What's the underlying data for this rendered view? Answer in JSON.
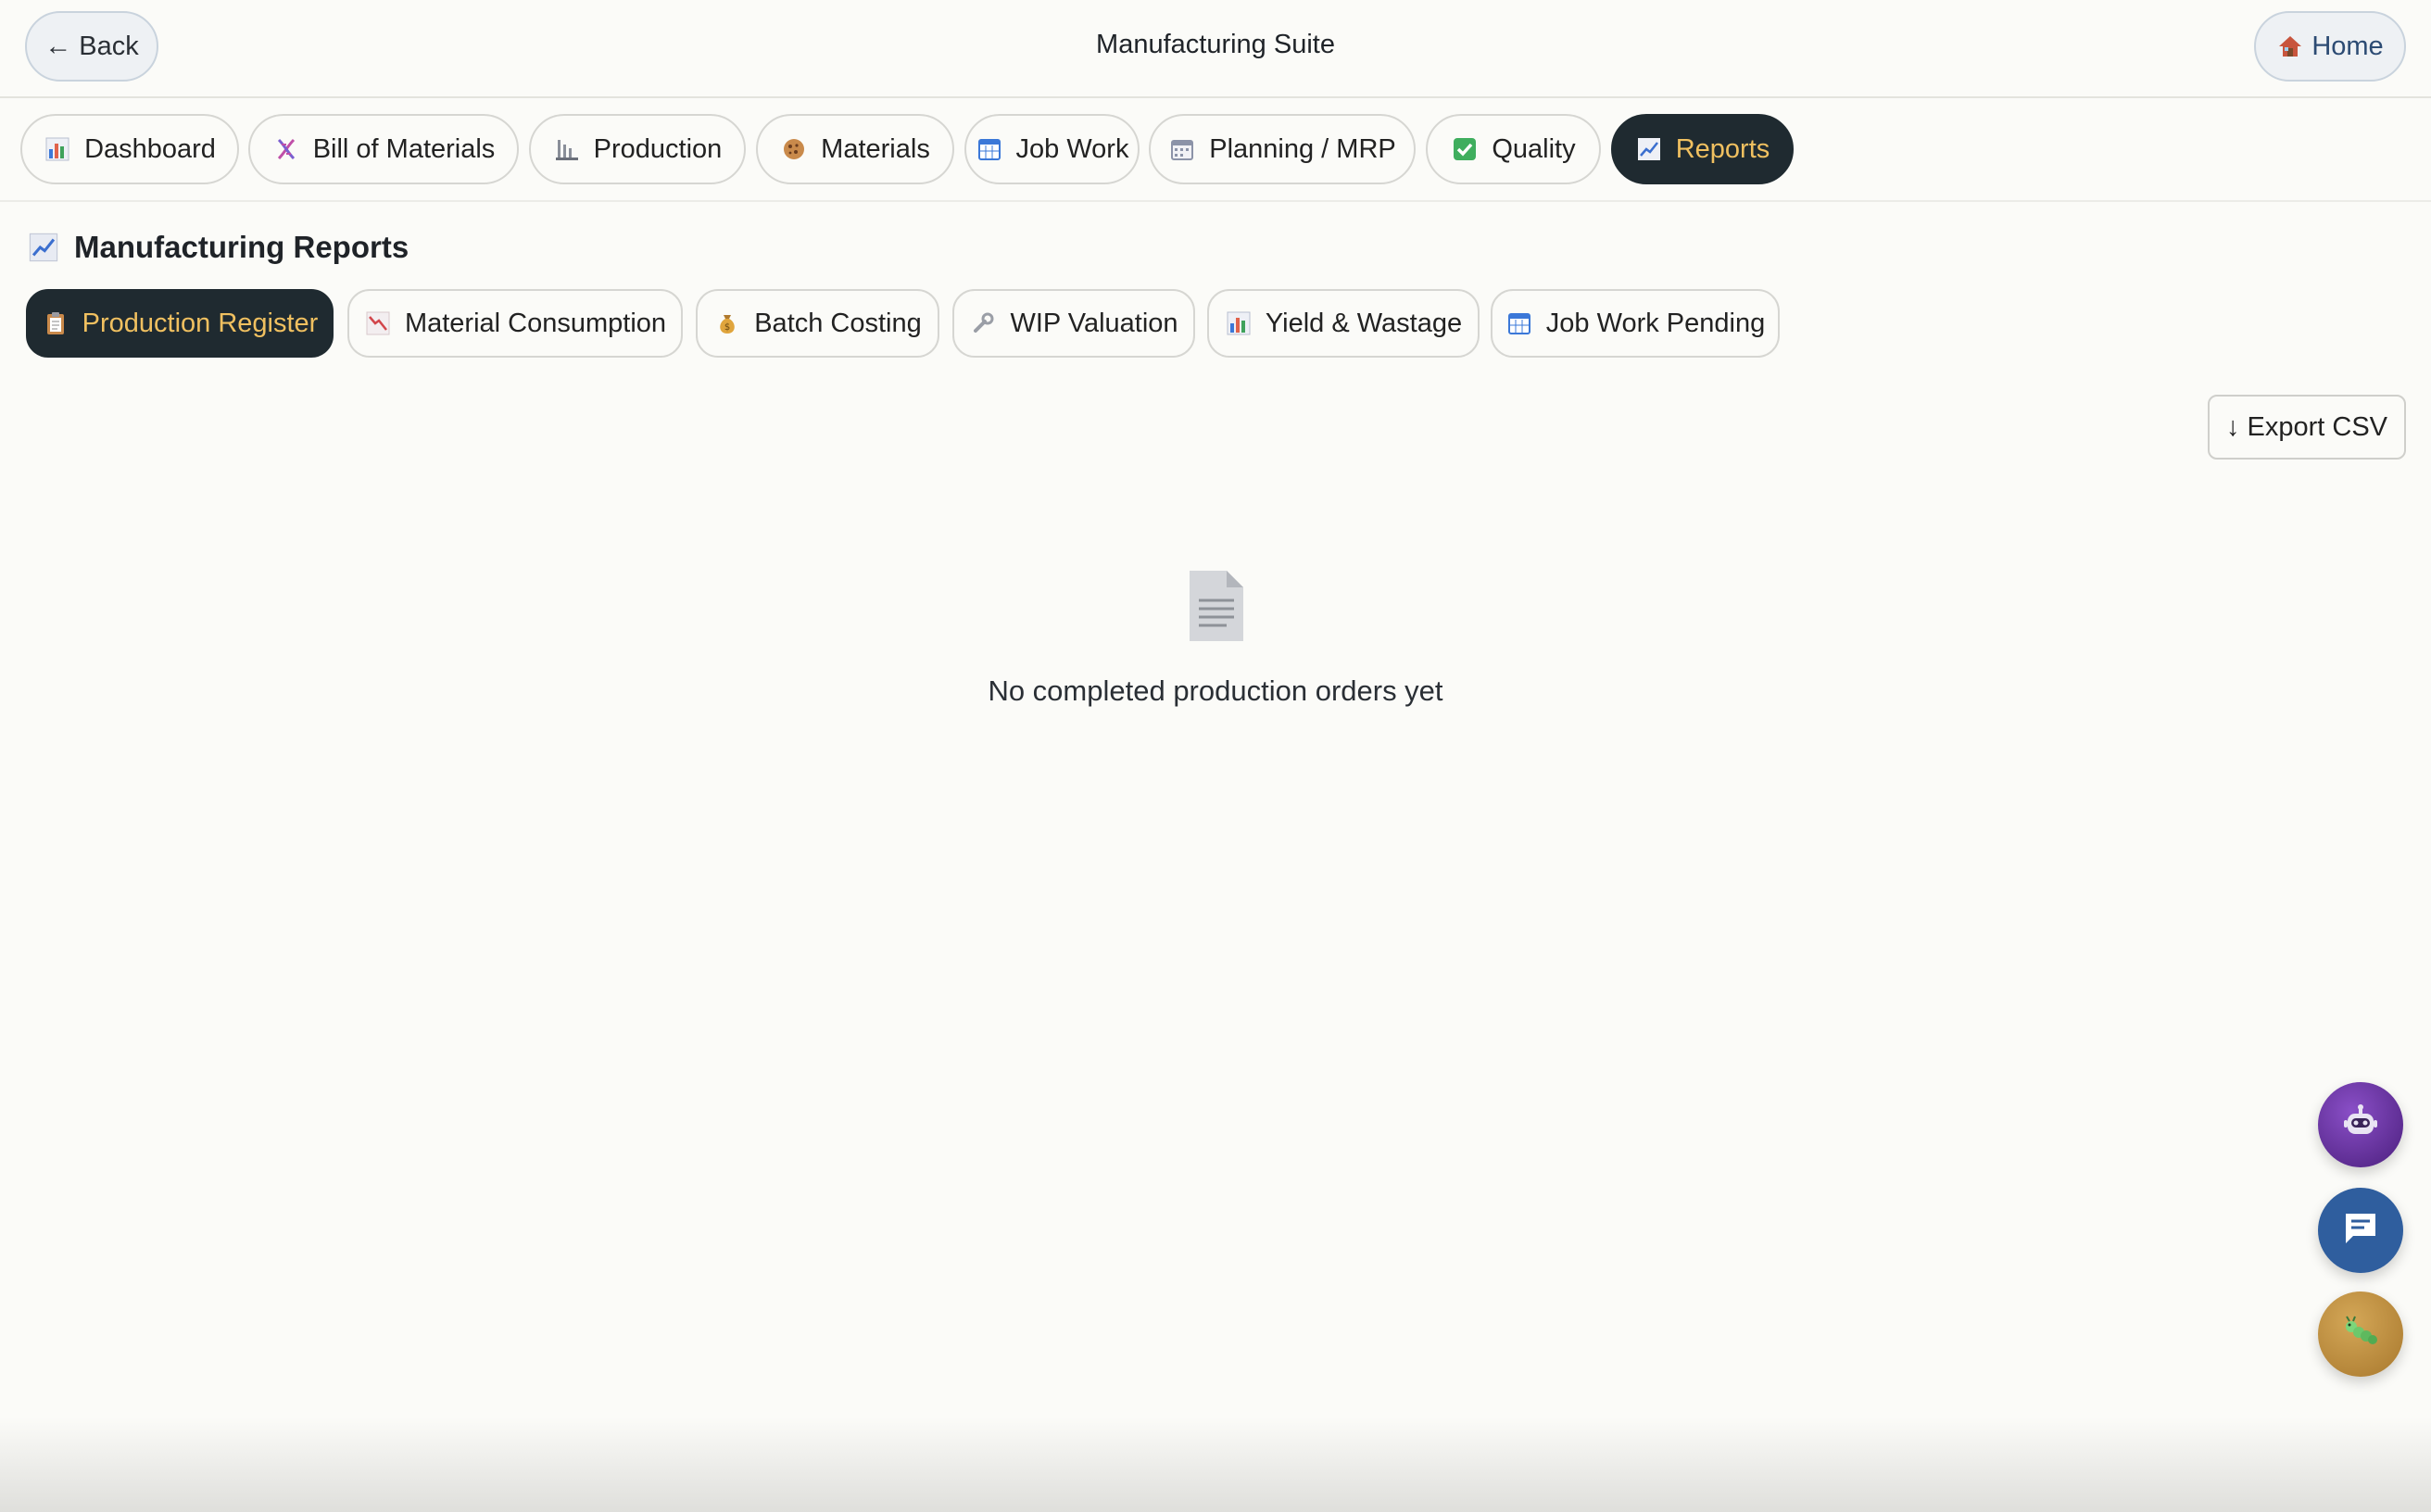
{
  "header": {
    "back_label": "← Back",
    "title": "Manufacturing Suite",
    "home_label": "Home"
  },
  "tabs": [
    {
      "label": "Dashboard",
      "icon": "bar-chart-icon"
    },
    {
      "label": "Bill of Materials",
      "icon": "dna-icon"
    },
    {
      "label": "Production",
      "icon": "factory-icon"
    },
    {
      "label": "Materials",
      "icon": "cookie-icon"
    },
    {
      "label": "Job Work",
      "icon": "calendar-grid-icon"
    },
    {
      "label": "Planning / MRP",
      "icon": "calendar-icon"
    },
    {
      "label": "Quality",
      "icon": "check-icon"
    },
    {
      "label": "Reports",
      "icon": "trend-up-icon",
      "active": true
    }
  ],
  "section": {
    "title": "Manufacturing Reports",
    "icon": "trend-up-icon"
  },
  "subtabs": [
    {
      "label": "Production Register",
      "icon": "clipboard-icon",
      "active": true
    },
    {
      "label": "Material Consumption",
      "icon": "trend-down-icon"
    },
    {
      "label": "Batch Costing",
      "icon": "money-bag-icon"
    },
    {
      "label": "WIP Valuation",
      "icon": "wrench-icon"
    },
    {
      "label": "Yield & Wastage",
      "icon": "bar-chart-icon"
    },
    {
      "label": "Job Work Pending",
      "icon": "calendar-grid-icon"
    }
  ],
  "export_label": "↓ Export CSV",
  "empty_state": {
    "icon": "document-icon",
    "message": "No completed production orders yet"
  },
  "colors": {
    "active_bg": "#1f2a30",
    "active_text": "#f0c060",
    "background": "#fbfbf8"
  },
  "fabs": [
    {
      "name": "assistant-bot-button",
      "icon": "robot-icon"
    },
    {
      "name": "chat-button",
      "icon": "chat-icon"
    },
    {
      "name": "report-bug-button",
      "icon": "bug-icon"
    }
  ]
}
